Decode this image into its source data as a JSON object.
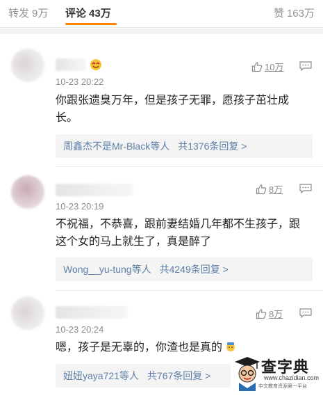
{
  "tabs": {
    "repost": {
      "label": "转发",
      "count": "9万"
    },
    "comment": {
      "label": "评论",
      "count": "43万"
    },
    "like": {
      "label": "赞",
      "count": "163万"
    }
  },
  "comments": [
    {
      "time": "10-23 20:22",
      "likes": "10万",
      "text_line1": "你跟张遗臭万年，但是孩子无罪，愿孩子茁壮成",
      "text_line2": "长。",
      "reply_summary": "周鑫杰不是Mr-Black等人",
      "reply_count": "共1376条回复 >"
    },
    {
      "time": "10-23 20:19",
      "likes": "8万",
      "text_line1": "不祝福，不恭喜，跟前妻结婚几年都不生孩子，跟",
      "text_line2": "这个女的马上就生了，真是醉了",
      "reply_summary": "Wong__yu-tung等人",
      "reply_count": "共4249条回复 >"
    },
    {
      "time": "10-23 20:24",
      "likes": "8万",
      "text_line1": "嗯，孩子是无辜的，你渣也是真的",
      "reply_summary": "妞妞yaya721等人",
      "reply_count": "共767条回复 >"
    }
  ],
  "watermark": {
    "title": "查字典",
    "url": "www.chazidian.com",
    "sub": "中文教育资源第一平台"
  },
  "colors": {
    "accent_orange": "#ff8200",
    "link_blue": "#5d7fa8",
    "meta_gray": "#8c8c8c"
  }
}
